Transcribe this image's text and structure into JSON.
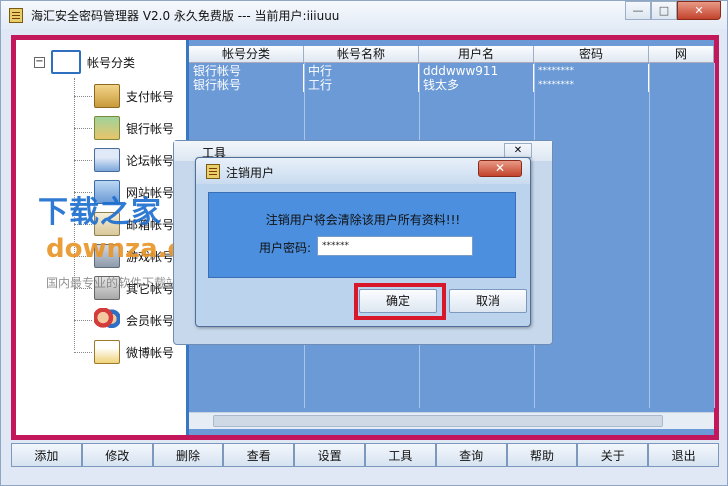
{
  "window": {
    "title": "海汇安全密码管理器 V2.0 永久免费版 --- 当前用户:iiiuuu",
    "min": "—",
    "max": "□",
    "close": "✕"
  },
  "tree": {
    "root": "帐号分类",
    "items": [
      {
        "label": "支付帐号",
        "icon": "calculator-icon"
      },
      {
        "label": "银行帐号",
        "icon": "bank-card-icon"
      },
      {
        "label": "论坛帐号",
        "icon": "forum-window-icon"
      },
      {
        "label": "网站帐号",
        "icon": "network-icon"
      },
      {
        "label": "邮箱帐号",
        "icon": "mail-icon"
      },
      {
        "label": "游戏帐号",
        "icon": "game-icon"
      },
      {
        "label": "其它帐号",
        "icon": "other-icon"
      },
      {
        "label": "会员帐号",
        "icon": "members-icon"
      },
      {
        "label": "微博帐号",
        "icon": "document-icon"
      }
    ]
  },
  "grid": {
    "columns": [
      "帐号分类",
      "帐号名称",
      "用户名",
      "密码",
      "网"
    ],
    "rows": [
      [
        "银行帐号",
        "中行",
        "dddwww911",
        "********"
      ],
      [
        "银行帐号",
        "工行",
        "钱太多",
        "********"
      ]
    ]
  },
  "background_dialog": {
    "title": "工具",
    "close": "✕"
  },
  "dialog": {
    "title": "注销用户",
    "close": "✕",
    "message": "注销用户将会清除该用户所有资料!!!",
    "password_label": "用户密码:",
    "password_value": "******",
    "ok": "确定",
    "cancel": "取消"
  },
  "toolbar": [
    "添加",
    "修改",
    "删除",
    "查看",
    "设置",
    "工具",
    "查询",
    "帮助",
    "关于",
    "退出"
  ],
  "watermark": {
    "line1": "下载之家",
    "line2": "downza.cn",
    "line3": "国内最专业的软件下载站"
  },
  "colors": {
    "frame_border": "#c2185b",
    "grid_bg": "#6b9ad6",
    "highlight": "#d8172a"
  }
}
